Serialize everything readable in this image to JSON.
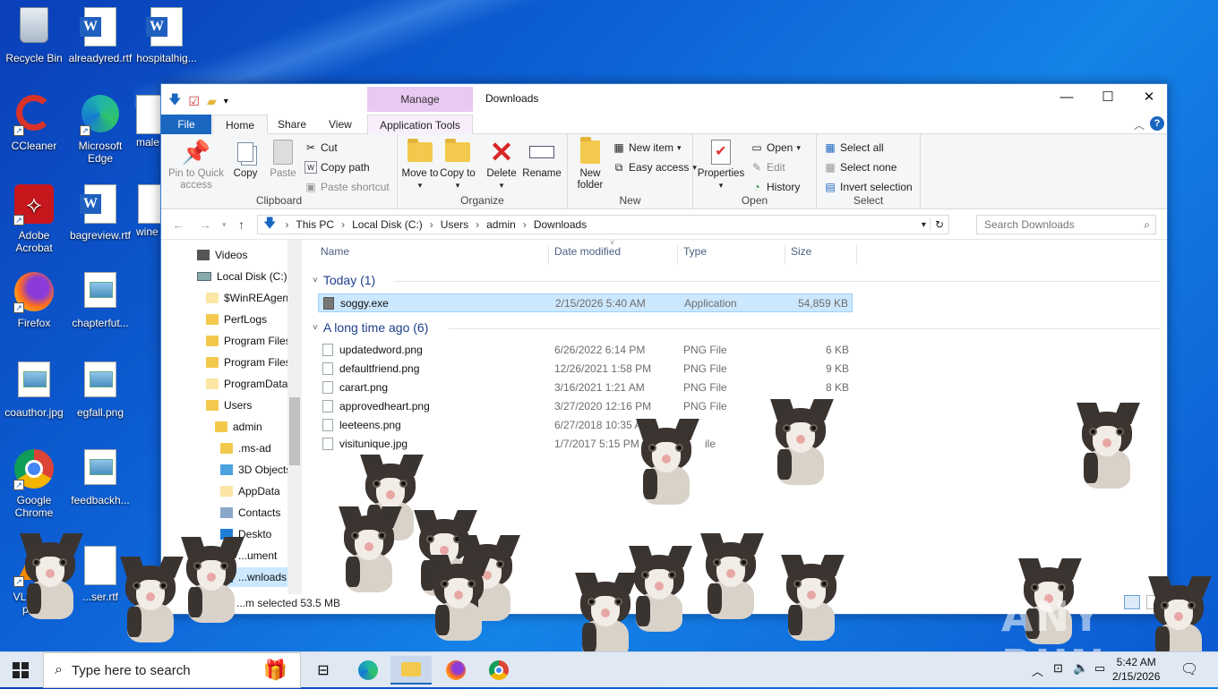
{
  "desktop": {
    "icons": [
      {
        "label": "Recycle Bin"
      },
      {
        "label": "alreadyred.rtf"
      },
      {
        "label": "hospitalhig..."
      },
      {
        "label": "CCleaner"
      },
      {
        "label": "Microsoft Edge"
      },
      {
        "label": "male"
      },
      {
        "label": "Adobe Acrobat"
      },
      {
        "label": "bagreview.rtf"
      },
      {
        "label": "wine"
      },
      {
        "label": "Firefox"
      },
      {
        "label": "chapterfut..."
      },
      {
        "label": "coauthor.jpg"
      },
      {
        "label": "egfall.png"
      },
      {
        "label": "Google Chrome"
      },
      {
        "label": "feedbackh..."
      },
      {
        "label": "VLC m... pla..."
      },
      {
        "label": "...ser.rtf"
      }
    ]
  },
  "window": {
    "title": "Downloads",
    "manage_tab": "Manage",
    "tabs": [
      "File",
      "Home",
      "Share",
      "View",
      "Application Tools"
    ],
    "ribbon": {
      "clipboard": {
        "name": "Clipboard",
        "pin": "Pin to Quick access",
        "copy": "Copy",
        "paste": "Paste",
        "cut": "Cut",
        "copy_path": "Copy path",
        "paste_shortcut": "Paste shortcut"
      },
      "organize": {
        "name": "Organize",
        "move_to": "Move to",
        "copy_to": "Copy to",
        "delete": "Delete",
        "rename": "Rename"
      },
      "new": {
        "name": "New",
        "new_folder": "New folder",
        "new_item": "New item",
        "easy_access": "Easy access"
      },
      "open": {
        "name": "Open",
        "properties": "Properties",
        "open": "Open",
        "edit": "Edit",
        "history": "History"
      },
      "select": {
        "name": "Select",
        "select_all": "Select all",
        "select_none": "Select none",
        "invert": "Invert selection"
      }
    },
    "address": {
      "crumbs": [
        "This PC",
        "Local Disk (C:)",
        "Users",
        "admin",
        "Downloads"
      ],
      "search_placeholder": "Search Downloads"
    },
    "nav": [
      "Videos",
      "Local Disk (C:)",
      "$WinREAgent",
      "PerfLogs",
      "Program Files",
      "Program Files",
      "ProgramData",
      "Users",
      "admin",
      ".ms-ad",
      "3D Objects",
      "AppData",
      "Contacts",
      "Deskto",
      "...ument",
      "...wnloads"
    ],
    "columns": [
      "Name",
      "Date modified",
      "Type",
      "Size"
    ],
    "groups": [
      {
        "title": "Today (1)",
        "files": [
          {
            "name": "soggy.exe",
            "date": "2/15/2026 5:40 AM",
            "type": "Application",
            "size": "54,859 KB"
          }
        ]
      },
      {
        "title": "A long time ago (6)",
        "files": [
          {
            "name": "updatedword.png",
            "date": "6/26/2022 6:14 PM",
            "type": "PNG File",
            "size": "6 KB"
          },
          {
            "name": "defaultfriend.png",
            "date": "12/26/2021 1:58 PM",
            "type": "PNG File",
            "size": "9 KB"
          },
          {
            "name": "carart.png",
            "date": "3/16/2021 1:21 AM",
            "type": "PNG File",
            "size": "8 KB"
          },
          {
            "name": "approvedheart.png",
            "date": "3/27/2020 12:16 PM",
            "type": "PNG File",
            "size": ""
          },
          {
            "name": "leeteens.png",
            "date": "6/27/2018 10:35 A",
            "type": "",
            "size": ""
          },
          {
            "name": "visitunique.jpg",
            "date": "1/7/2017 5:15 PM",
            "type": "ile",
            "size": ""
          }
        ]
      }
    ],
    "status": "...m selected  53.5 MB"
  },
  "taskbar": {
    "search_placeholder": "Type here to search",
    "time": "5:42 AM",
    "date": "2/15/2026"
  },
  "watermark": "ANY RUN"
}
